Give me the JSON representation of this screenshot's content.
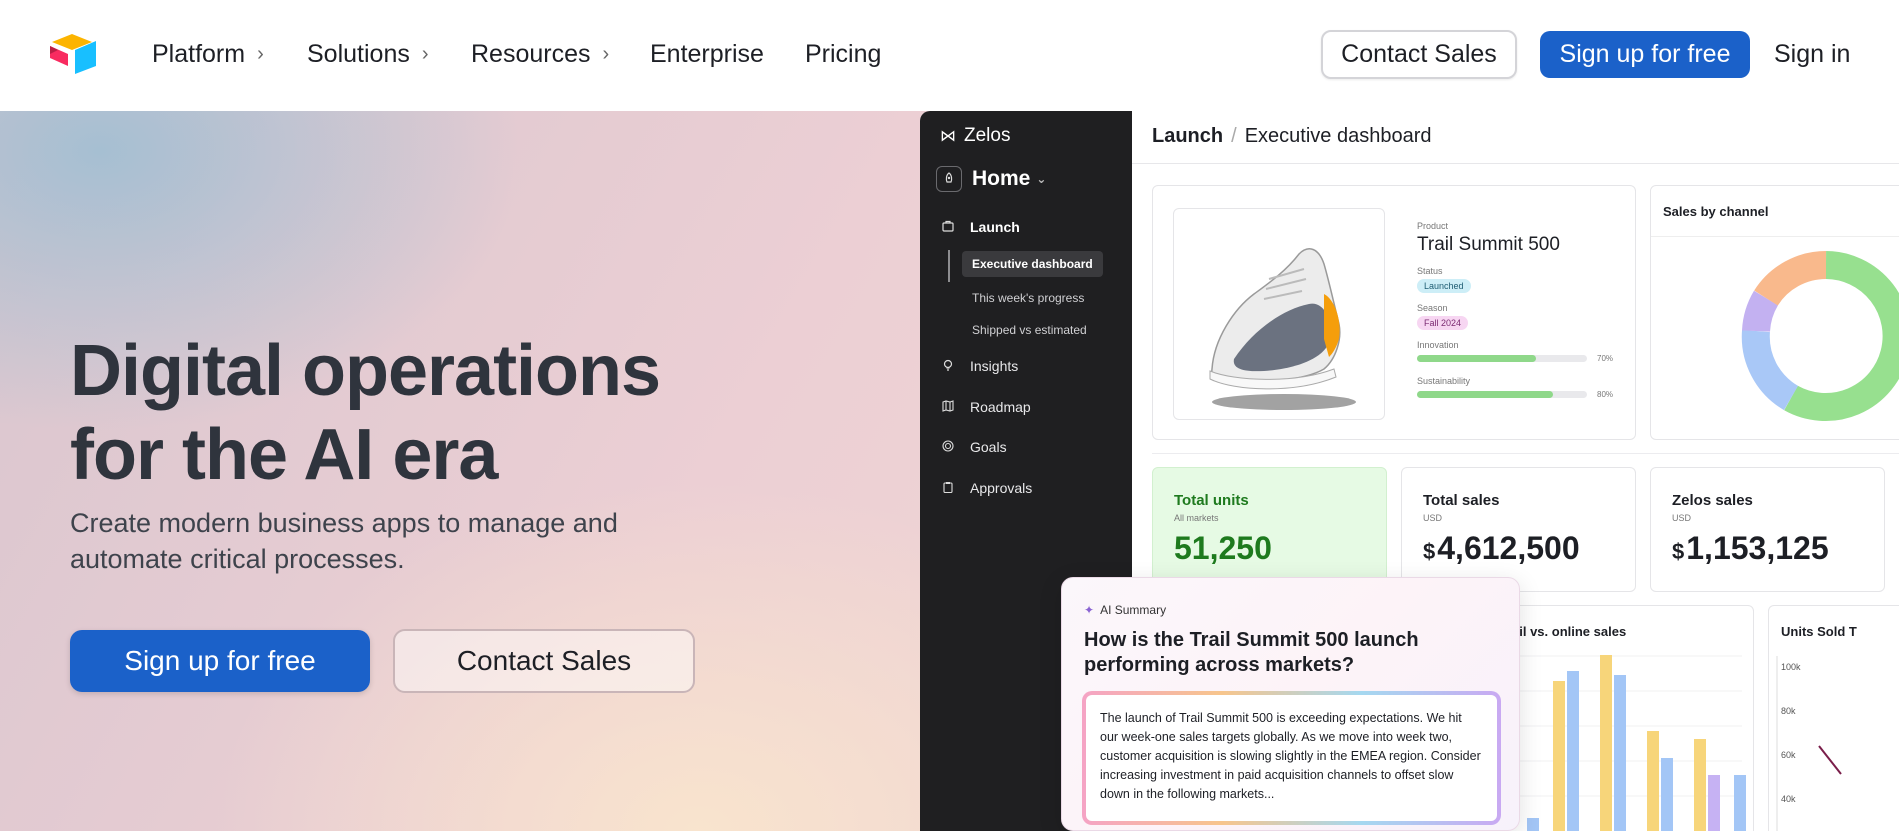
{
  "nav": {
    "items": [
      {
        "label": "Platform",
        "has_chevron": true
      },
      {
        "label": "Solutions",
        "has_chevron": true
      },
      {
        "label": "Resources",
        "has_chevron": true
      },
      {
        "label": "Enterprise",
        "has_chevron": false
      },
      {
        "label": "Pricing",
        "has_chevron": false
      }
    ],
    "contact_sales": "Contact Sales",
    "signup": "Sign up for free",
    "signin": "Sign in",
    "chevron": "›"
  },
  "hero": {
    "title_line1": "Digital operations",
    "title_line2": "for the AI era",
    "subtitle_line1": "Create modern business apps to manage and",
    "subtitle_line2": "automate critical processes.",
    "primary_cta": "Sign up for free",
    "secondary_cta": "Contact Sales"
  },
  "app": {
    "brand": "Zelos",
    "home": "Home",
    "sidebar": {
      "launch": "Launch",
      "sub_items": [
        "Executive dashboard",
        "This week's progress",
        "Shipped vs estimated"
      ],
      "items": [
        "Insights",
        "Roadmap",
        "Goals",
        "Approvals"
      ]
    },
    "breadcrumb": {
      "root": "Launch",
      "sep": "/",
      "current": "Executive dashboard"
    },
    "product": {
      "label": "Product",
      "name": "Trail Summit 500",
      "status_label": "Status",
      "status": "Launched",
      "season_label": "Season",
      "season": "Fall 2024",
      "innovation_label": "Innovation",
      "innovation_pct": "70%",
      "innovation_value": 0.7,
      "sustainability_label": "Sustainability",
      "sustainability_pct": "80%",
      "sustainability_value": 0.8
    },
    "sales_by_channel": {
      "title": "Sales by channel"
    },
    "kpis": [
      {
        "title": "Total units",
        "sub": "All markets",
        "currency": "",
        "value": "51,250"
      },
      {
        "title": "Total sales",
        "sub": "USD",
        "currency": "$",
        "value": "4,612,500"
      },
      {
        "title": "Zelos sales",
        "sub": "USD",
        "currency": "$",
        "value": "1,153,125"
      }
    ],
    "retail_chart": {
      "title": "ail vs. online sales"
    },
    "units_chart": {
      "title": "Units Sold T",
      "ticks": [
        "100k",
        "80k",
        "60k",
        "40k"
      ]
    },
    "ai": {
      "label": "AI Summary",
      "question": "How is the Trail Summit 500 launch performing across markets?",
      "answer": "The launch of Trail Summit 500 is exceeding expectations. We hit our week-one sales targets globally. As we move into week two, customer acquisition is slowing slightly in the EMEA region. Consider increasing investment in paid acquisition channels to offset slow down in the following markets..."
    }
  },
  "colors": {
    "primary": "#1b61c9",
    "sidebar": "#1f1f21",
    "green_kpi": "#1e7a1e",
    "donut_green": "#97e08f",
    "donut_blue": "#a9c8f7",
    "donut_purple": "#c3b1f1",
    "donut_orange": "#f9b98c",
    "bar_yellow": "#f7d57a",
    "bar_blue": "#a3c6f6",
    "bar_purple": "#c6b2f3"
  }
}
